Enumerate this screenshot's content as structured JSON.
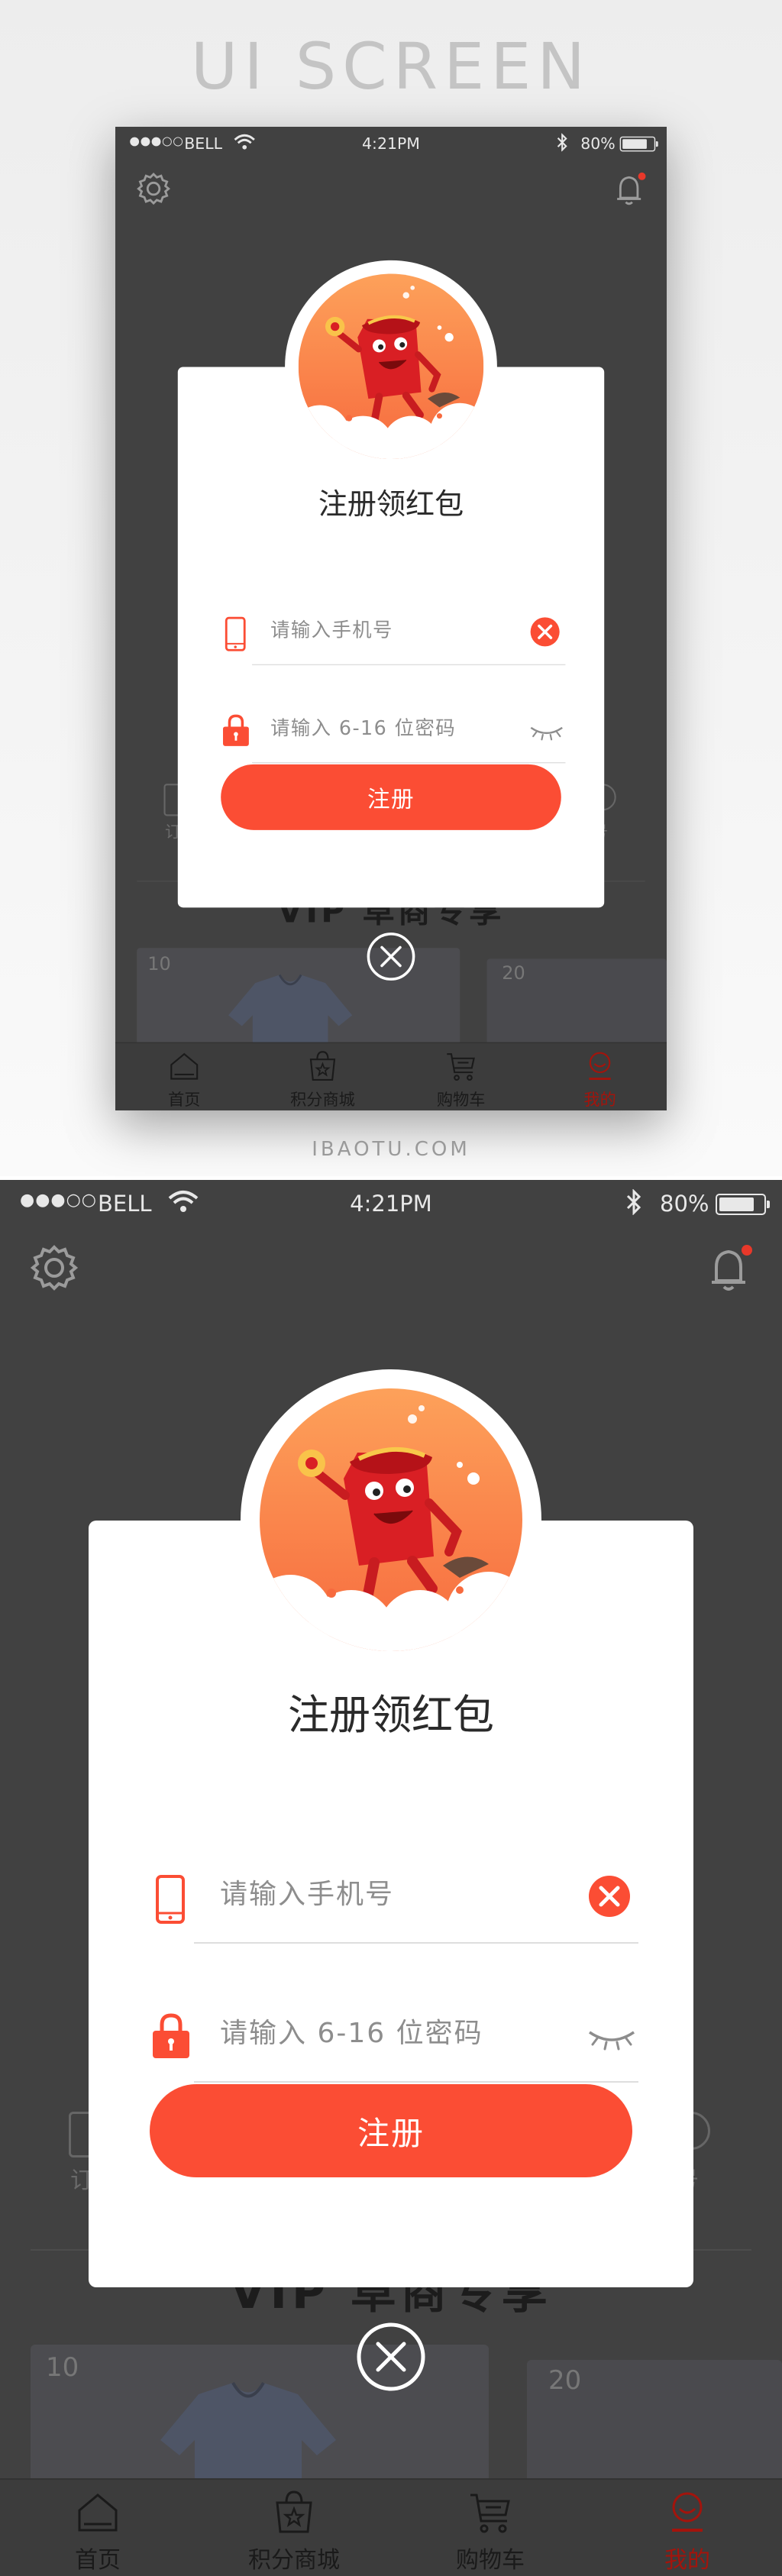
{
  "presentation": {
    "headline": "UI SCREEN",
    "site_mark": "IBAOTU.COM"
  },
  "status_bar": {
    "signal": "●●●○○",
    "carrier": "BELL",
    "time": "4:21PM",
    "battery_percent": "80%",
    "battery_level": 0.8
  },
  "header": {
    "settings_icon": "gear-icon",
    "notification_icon": "bell-icon",
    "notification_dot_color": "#e8382a"
  },
  "background": {
    "vip_text": "VIP 草商专享",
    "left_side_text": "订",
    "right_side_text": "号",
    "card_left_number": "10",
    "card_right_number": "20"
  },
  "dialog": {
    "title": "注册领红包",
    "phone_placeholder": "请输入手机号",
    "password_placeholder": "请输入 6-16 位密码",
    "submit_label": "注册",
    "accent_color": "#fb4d34",
    "icons": {
      "phone": "phone-icon",
      "lock": "lock-icon",
      "clear": "clear-icon",
      "visibility": "eye-closed-icon",
      "close": "close-circle-icon"
    }
  },
  "tabbar": {
    "items": [
      {
        "label": "首页",
        "icon": "home-icon"
      },
      {
        "label": "积分商城",
        "icon": "shop-bag-icon"
      },
      {
        "label": "购物车",
        "icon": "cart-icon"
      },
      {
        "label": "我的",
        "icon": "profile-icon",
        "active": true
      }
    ],
    "active_color": "#a3140c"
  }
}
